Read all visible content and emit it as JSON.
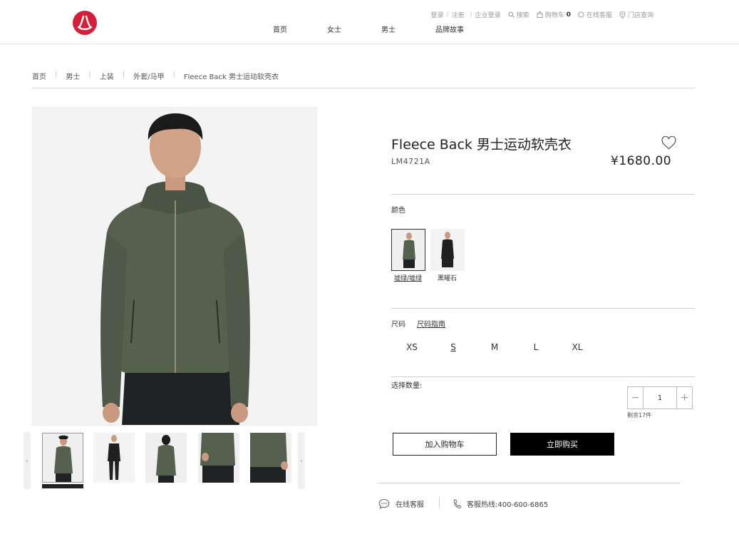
{
  "header": {
    "brand": "lululemon",
    "util": {
      "login": "登录",
      "register": "注册",
      "enterprise_login": "企业登录",
      "search": "搜索",
      "cart": "购物车",
      "cart_count": "0",
      "online_service": "在线客服",
      "store_finder": "门店查询"
    },
    "nav": [
      "首页",
      "女士",
      "男士",
      "品牌故事"
    ]
  },
  "breadcrumb": [
    "首页",
    "男士",
    "上装",
    "外套/马甲",
    "Fleece Back 男士运动软壳衣"
  ],
  "product": {
    "title": "Fleece Back 男士运动软壳衣",
    "sku": "LM4721A",
    "price": "¥1680.00",
    "color_label": "颜色",
    "colors": [
      {
        "name": "墟绿/墟绿",
        "selected": true,
        "hex": "#56604f"
      },
      {
        "name": "黑曜石",
        "selected": false,
        "hex": "#1f1f1f"
      }
    ],
    "size_label": "尺码",
    "size_guide": "尺码指南",
    "sizes": [
      "XS",
      "S",
      "M",
      "L",
      "XL"
    ],
    "selected_size": "S",
    "quantity_label": "选择数量:",
    "quantity": "1",
    "qty_minus": "−",
    "qty_plus": "+",
    "stock_text": "剩余17件",
    "add_to_cart": "加入购物车",
    "buy_now": "立即购买"
  },
  "service": {
    "online": "在线客服",
    "hotline": "客服热线:400-600-6865"
  },
  "colors": {
    "brand_red": "#d31f3a",
    "jacket_green": "#56604f",
    "black": "#000000"
  }
}
